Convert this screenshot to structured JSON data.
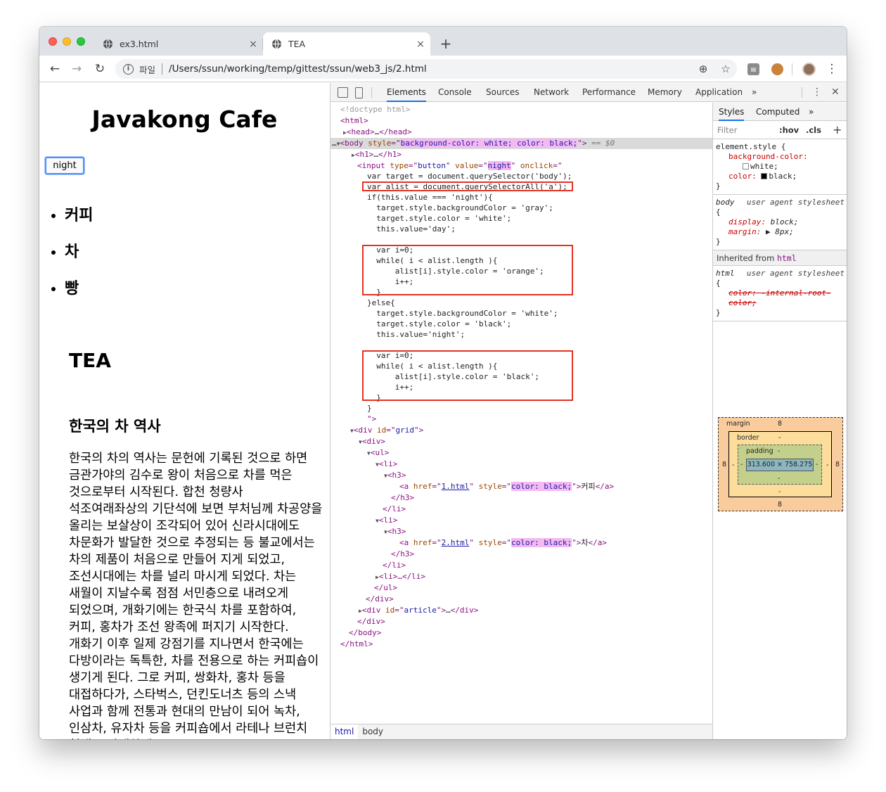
{
  "browser": {
    "tabs": [
      {
        "title": "ex3.html",
        "close": "×"
      },
      {
        "title": "TEA",
        "close": "×"
      }
    ],
    "new_tab": "+",
    "address": {
      "scheme": "파일",
      "url": "/Users/ssun/working/temp/gittest/ssun/web3_js/2.html"
    }
  },
  "page": {
    "h1": "Javakong Cafe",
    "button_label": "night",
    "menu": [
      "커피",
      "차",
      "빵"
    ],
    "title": "TEA",
    "subtitle": "한국의 차 역사",
    "article": "한국의 차의 역사는 문헌에 기록된 것으로 하면 금관가야의 김수로 왕이 처음으로 차를 먹은 것으로부터 시작된다. 합천 청량사 석조여래좌상의 기단석에 보면 부처님께 차공양을 올리는 보살상이 조각되어 있어 신라시대에도 차문화가 발달한 것으로 추정되는 등 불교에서는 차의 제품이 처음으로 만들어 지게 되었고, 조선시대에는 차를 널리 마시게 되었다. 차는 새월이 지날수록 점점 서민층으로 내려오게 되었으며, 개화기에는 한국식 차를 포함하여, 커피, 홍차가 조선 왕족에 퍼지기 시작한다. 개화기 이후 일제 강점기를 지나면서 한국에는 다방이라는 독특한, 차를 전용으로 하는 커피숍이 생기게 된다. 그로 커피, 쌍화차, 홍차 등을 대접하다가, 스타벅스, 던킨도너츠 등의 스낵 사업과 함께 전통과 현대의 만남이 되어 녹차, 인삼차, 유자차 등을 커피숍에서 라테나 브런치 형태로 판매하게"
  },
  "devtools": {
    "tabs": [
      "Elements",
      "Console",
      "Sources",
      "Network",
      "Performance",
      "Memory",
      "Application",
      "»"
    ],
    "active_tab": "Elements",
    "code": {
      "doctype": "<!doctype html>",
      "html_open": "<html>",
      "head_tag": "<head>",
      "head_ellipsis": "…",
      "head_close": "</head>",
      "body_tag": "<body",
      "body_attr": "style",
      "body_style": "background-color: white; color: black;",
      "body_eq": "== $0",
      "h1_tag": "<h1>",
      "h1_ellipsis": "…",
      "h1_close": "</h1>",
      "input_tag": "<input",
      "input_type_attr": "type",
      "input_type_val": "button",
      "input_value_attr": "value",
      "input_value_val": "night",
      "input_onclick_attr": "onclick",
      "js": [
        "var target = document.querySelector('body');",
        "var alist = document.querySelectorAll('a');",
        "if(this.value === 'night'){",
        "  target.style.backgroundColor = 'gray';",
        "  target.style.color = 'white';",
        "  this.value='day';",
        "  var i=0;",
        "  while( i < alist.length ){",
        "      alist[i].style.color = 'orange';",
        "      i++;",
        "  }",
        "}else{",
        "  target.style.backgroundColor = 'white';",
        "  target.style.color = 'black';",
        "  this.value='night';",
        "  var i=0;",
        "  while( i < alist.length ){",
        "      alist[i].style.color = 'black';",
        "      i++;",
        "  }",
        "}",
        "\">"
      ],
      "div_grid_tag": "<div",
      "div_id_attr": "id",
      "div_grid_val": "grid",
      "div_tag": "<div>",
      "ul_tag": "<ul>",
      "li_tag": "<li>",
      "h3_tag": "<h3>",
      "a_tag": "<a",
      "href_attr": "href",
      "href1": "1.html",
      "href2": "2.html",
      "style_attr": "style",
      "a_style": "color: black;",
      "a1_text": "커피",
      "a2_text": "차",
      "a_close": "</a>",
      "h3_close": "</h3>",
      "li_close": "</li>",
      "li_collapsed": "<li>…</li>",
      "ul_close": "</ul>",
      "div_close": "</div>",
      "div_article_val": "article",
      "div_article_ellipsis": "…",
      "body_close": "</body>",
      "html_close": "</html>",
      "close_bracket": ">",
      "quote_open": "=\"",
      "quote_close": "\""
    },
    "breadcrumbs": [
      "html",
      "body"
    ],
    "styles": {
      "tabs": [
        "Styles",
        "Computed",
        "»"
      ],
      "filter_placeholder": "Filter",
      "hov": ":hov",
      "cls": ".cls",
      "plus": "+",
      "element_style_selector": "element.style {",
      "element_style_props": [
        {
          "name": "background-color:",
          "value": "white;",
          "swatch": "#ffffff"
        },
        {
          "name": "color:",
          "value": "black;",
          "swatch": "#000000"
        }
      ],
      "close_brace": "}",
      "body_selector": "body",
      "body_source": "user agent stylesheet",
      "open_brace": "{",
      "body_props": [
        {
          "name": "display:",
          "value": "block;"
        },
        {
          "name": "margin:",
          "value": "▶ 8px;"
        }
      ],
      "inherited_label": "Inherited from",
      "inherited_tag": "html",
      "html_selector": "html",
      "html_source": "user agent stylesheet",
      "html_prop_name": "color:",
      "html_prop_value": "-internal-root-color;"
    },
    "box_model": {
      "margin_label": "margin",
      "margin": "8",
      "border_label": "border",
      "border": "-",
      "padding_label": "padding",
      "padding": "-",
      "content": "313.600 × 758.275",
      "side": "8"
    }
  },
  "colors": {
    "red_box": "#e53222",
    "tag": "#881280",
    "attr_name": "#994500",
    "attr_value": "#1a1aa6",
    "active_tab_underline": "#1a73e8"
  }
}
